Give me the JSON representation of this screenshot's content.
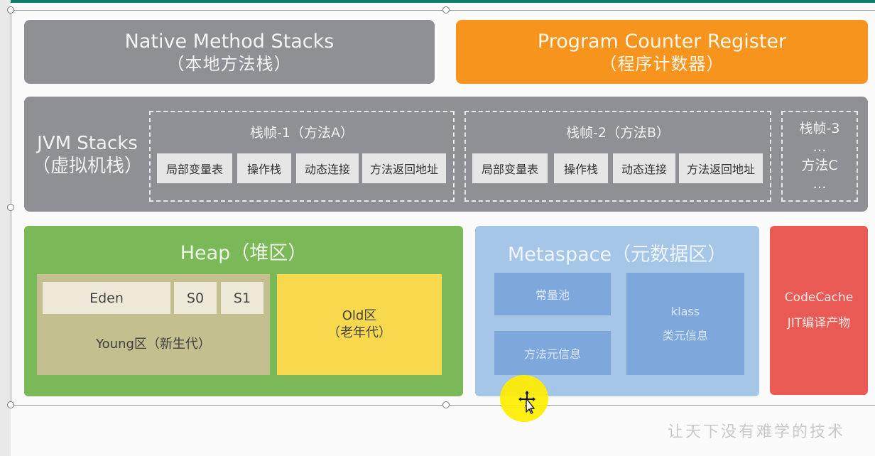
{
  "native_method_stacks": {
    "title": "Native Method Stacks",
    "subtitle": "（本地方法栈）"
  },
  "program_counter_register": {
    "title": "Program Counter Register",
    "subtitle": "（程序计数器）"
  },
  "jvm_stacks": {
    "title": "JVM Stacks",
    "subtitle": "（虚拟机栈）",
    "frames": [
      {
        "title": "栈帧-1（方法A）",
        "cells": [
          "局部变量表",
          "操作栈",
          "动态连接",
          "方法返回地址"
        ]
      },
      {
        "title": "栈帧-2（方法B）",
        "cells": [
          "局部变量表",
          "操作栈",
          "动态连接",
          "方法返回地址"
        ]
      }
    ],
    "frame_c": {
      "title": "栈帧-3",
      "dots_top": "…",
      "label": "方法C",
      "dots_bottom": "…"
    }
  },
  "heap": {
    "title": "Heap（堆区）",
    "eden": "Eden",
    "s0": "S0",
    "s1": "S1",
    "young": "Young区（新生代）",
    "old_line1": "Old区",
    "old_line2": "（老年代）"
  },
  "metaspace": {
    "title": "Metaspace（元数据区）",
    "constant_pool": "常量池",
    "method_meta": "方法元信息",
    "klass": "klass",
    "klass_meta": "类元信息"
  },
  "code_cache": {
    "title": "CodeCache",
    "subtitle": "JIT编译产物"
  },
  "watermark": "让天下没有难学的技术",
  "colors": {
    "gray": "#8f8f96",
    "orange": "#f7941e",
    "green": "#7bb858",
    "yellow": "#f8d84c",
    "blue": "#a6c6e8",
    "red": "#ea5a55",
    "cursor_highlight": "#ffee00"
  },
  "icons": [
    "move-cursor-icon"
  ]
}
